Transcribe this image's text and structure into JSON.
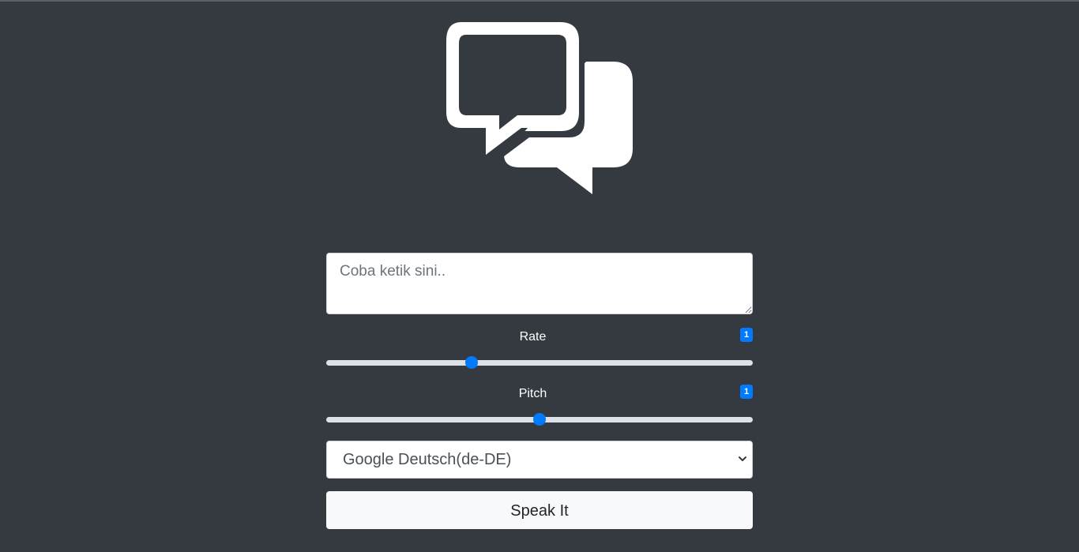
{
  "icons": {
    "logo": "chat-bubbles-icon",
    "select_arrow": "chevron-down-icon"
  },
  "colors": {
    "background": "#343a40",
    "accent": "#007bff",
    "button_bg": "#f8f9fa"
  },
  "text_input": {
    "placeholder": "Coba ketik sini..",
    "value": ""
  },
  "rate": {
    "label": "Rate",
    "badge": "1",
    "slider_fraction": 0.34
  },
  "pitch": {
    "label": "Pitch",
    "badge": "1",
    "slider_fraction": 0.5
  },
  "voice_select": {
    "selected": "Google Deutsch(de-DE)"
  },
  "speak_button": {
    "label": "Speak It"
  }
}
